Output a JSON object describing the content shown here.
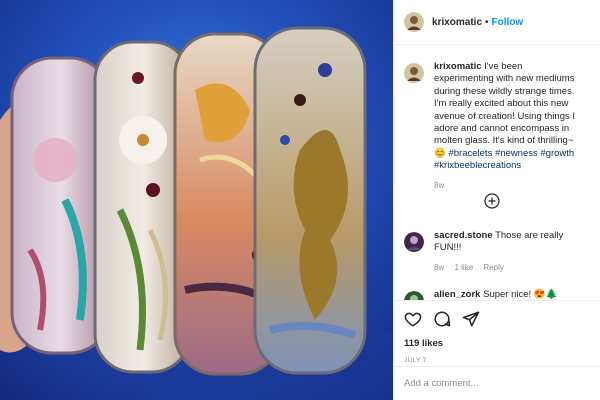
{
  "header": {
    "username": "krixomatic",
    "separator": "•",
    "follow_label": "Follow"
  },
  "caption": {
    "username": "krixomatic",
    "text": "I've been experimenting with new mediums during these wildly strange times. I'm really excited about this new avenue of creation! Using things I adore and cannot encompass in molten glass. It's kind of thrilling~ ",
    "emoji": "😊",
    "hashtags": [
      "#bracelets",
      "#newness",
      "#growth",
      "#krixbeeblecreations"
    ],
    "time": "8w"
  },
  "comments": [
    {
      "username": "sacred.stone",
      "text": "Those are really FUN!!!",
      "time": "8w",
      "likes": "1 like",
      "reply_label": "Reply"
    },
    {
      "username": "alien_zork",
      "text": "Super nice! 😍🌲"
    }
  ],
  "actions": {
    "likes": "119 likes",
    "date": "JULY 7"
  },
  "add_comment": {
    "placeholder": "Add a comment..."
  },
  "icons": {
    "more_comments": "plus-circle-icon",
    "like": "heart-icon",
    "comment": "comment-icon",
    "share": "share-icon"
  },
  "colors": {
    "link": "#0095f6",
    "hashtag": "#00376b",
    "muted": "#8e8e8e",
    "border": "#efefef"
  }
}
